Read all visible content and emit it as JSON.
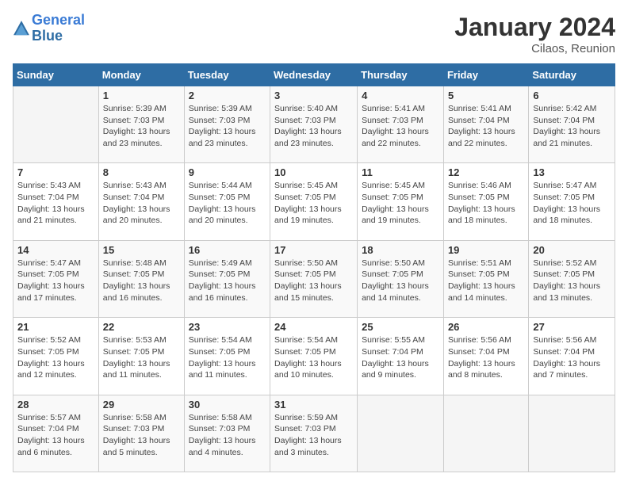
{
  "logo": {
    "line1": "General",
    "line2": "Blue"
  },
  "title": "January 2024",
  "subtitle": "Cilaos, Reunion",
  "weekdays": [
    "Sunday",
    "Monday",
    "Tuesday",
    "Wednesday",
    "Thursday",
    "Friday",
    "Saturday"
  ],
  "weeks": [
    [
      {
        "day": "",
        "sunrise": "",
        "sunset": "",
        "daylight": ""
      },
      {
        "day": "1",
        "sunrise": "Sunrise: 5:39 AM",
        "sunset": "Sunset: 7:03 PM",
        "daylight": "Daylight: 13 hours and 23 minutes."
      },
      {
        "day": "2",
        "sunrise": "Sunrise: 5:39 AM",
        "sunset": "Sunset: 7:03 PM",
        "daylight": "Daylight: 13 hours and 23 minutes."
      },
      {
        "day": "3",
        "sunrise": "Sunrise: 5:40 AM",
        "sunset": "Sunset: 7:03 PM",
        "daylight": "Daylight: 13 hours and 23 minutes."
      },
      {
        "day": "4",
        "sunrise": "Sunrise: 5:41 AM",
        "sunset": "Sunset: 7:03 PM",
        "daylight": "Daylight: 13 hours and 22 minutes."
      },
      {
        "day": "5",
        "sunrise": "Sunrise: 5:41 AM",
        "sunset": "Sunset: 7:04 PM",
        "daylight": "Daylight: 13 hours and 22 minutes."
      },
      {
        "day": "6",
        "sunrise": "Sunrise: 5:42 AM",
        "sunset": "Sunset: 7:04 PM",
        "daylight": "Daylight: 13 hours and 21 minutes."
      }
    ],
    [
      {
        "day": "7",
        "sunrise": "Sunrise: 5:43 AM",
        "sunset": "Sunset: 7:04 PM",
        "daylight": "Daylight: 13 hours and 21 minutes."
      },
      {
        "day": "8",
        "sunrise": "Sunrise: 5:43 AM",
        "sunset": "Sunset: 7:04 PM",
        "daylight": "Daylight: 13 hours and 20 minutes."
      },
      {
        "day": "9",
        "sunrise": "Sunrise: 5:44 AM",
        "sunset": "Sunset: 7:05 PM",
        "daylight": "Daylight: 13 hours and 20 minutes."
      },
      {
        "day": "10",
        "sunrise": "Sunrise: 5:45 AM",
        "sunset": "Sunset: 7:05 PM",
        "daylight": "Daylight: 13 hours and 19 minutes."
      },
      {
        "day": "11",
        "sunrise": "Sunrise: 5:45 AM",
        "sunset": "Sunset: 7:05 PM",
        "daylight": "Daylight: 13 hours and 19 minutes."
      },
      {
        "day": "12",
        "sunrise": "Sunrise: 5:46 AM",
        "sunset": "Sunset: 7:05 PM",
        "daylight": "Daylight: 13 hours and 18 minutes."
      },
      {
        "day": "13",
        "sunrise": "Sunrise: 5:47 AM",
        "sunset": "Sunset: 7:05 PM",
        "daylight": "Daylight: 13 hours and 18 minutes."
      }
    ],
    [
      {
        "day": "14",
        "sunrise": "Sunrise: 5:47 AM",
        "sunset": "Sunset: 7:05 PM",
        "daylight": "Daylight: 13 hours and 17 minutes."
      },
      {
        "day": "15",
        "sunrise": "Sunrise: 5:48 AM",
        "sunset": "Sunset: 7:05 PM",
        "daylight": "Daylight: 13 hours and 16 minutes."
      },
      {
        "day": "16",
        "sunrise": "Sunrise: 5:49 AM",
        "sunset": "Sunset: 7:05 PM",
        "daylight": "Daylight: 13 hours and 16 minutes."
      },
      {
        "day": "17",
        "sunrise": "Sunrise: 5:50 AM",
        "sunset": "Sunset: 7:05 PM",
        "daylight": "Daylight: 13 hours and 15 minutes."
      },
      {
        "day": "18",
        "sunrise": "Sunrise: 5:50 AM",
        "sunset": "Sunset: 7:05 PM",
        "daylight": "Daylight: 13 hours and 14 minutes."
      },
      {
        "day": "19",
        "sunrise": "Sunrise: 5:51 AM",
        "sunset": "Sunset: 7:05 PM",
        "daylight": "Daylight: 13 hours and 14 minutes."
      },
      {
        "day": "20",
        "sunrise": "Sunrise: 5:52 AM",
        "sunset": "Sunset: 7:05 PM",
        "daylight": "Daylight: 13 hours and 13 minutes."
      }
    ],
    [
      {
        "day": "21",
        "sunrise": "Sunrise: 5:52 AM",
        "sunset": "Sunset: 7:05 PM",
        "daylight": "Daylight: 13 hours and 12 minutes."
      },
      {
        "day": "22",
        "sunrise": "Sunrise: 5:53 AM",
        "sunset": "Sunset: 7:05 PM",
        "daylight": "Daylight: 13 hours and 11 minutes."
      },
      {
        "day": "23",
        "sunrise": "Sunrise: 5:54 AM",
        "sunset": "Sunset: 7:05 PM",
        "daylight": "Daylight: 13 hours and 11 minutes."
      },
      {
        "day": "24",
        "sunrise": "Sunrise: 5:54 AM",
        "sunset": "Sunset: 7:05 PM",
        "daylight": "Daylight: 13 hours and 10 minutes."
      },
      {
        "day": "25",
        "sunrise": "Sunrise: 5:55 AM",
        "sunset": "Sunset: 7:04 PM",
        "daylight": "Daylight: 13 hours and 9 minutes."
      },
      {
        "day": "26",
        "sunrise": "Sunrise: 5:56 AM",
        "sunset": "Sunset: 7:04 PM",
        "daylight": "Daylight: 13 hours and 8 minutes."
      },
      {
        "day": "27",
        "sunrise": "Sunrise: 5:56 AM",
        "sunset": "Sunset: 7:04 PM",
        "daylight": "Daylight: 13 hours and 7 minutes."
      }
    ],
    [
      {
        "day": "28",
        "sunrise": "Sunrise: 5:57 AM",
        "sunset": "Sunset: 7:04 PM",
        "daylight": "Daylight: 13 hours and 6 minutes."
      },
      {
        "day": "29",
        "sunrise": "Sunrise: 5:58 AM",
        "sunset": "Sunset: 7:03 PM",
        "daylight": "Daylight: 13 hours and 5 minutes."
      },
      {
        "day": "30",
        "sunrise": "Sunrise: 5:58 AM",
        "sunset": "Sunset: 7:03 PM",
        "daylight": "Daylight: 13 hours and 4 minutes."
      },
      {
        "day": "31",
        "sunrise": "Sunrise: 5:59 AM",
        "sunset": "Sunset: 7:03 PM",
        "daylight": "Daylight: 13 hours and 3 minutes."
      },
      {
        "day": "",
        "sunrise": "",
        "sunset": "",
        "daylight": ""
      },
      {
        "day": "",
        "sunrise": "",
        "sunset": "",
        "daylight": ""
      },
      {
        "day": "",
        "sunrise": "",
        "sunset": "",
        "daylight": ""
      }
    ]
  ]
}
